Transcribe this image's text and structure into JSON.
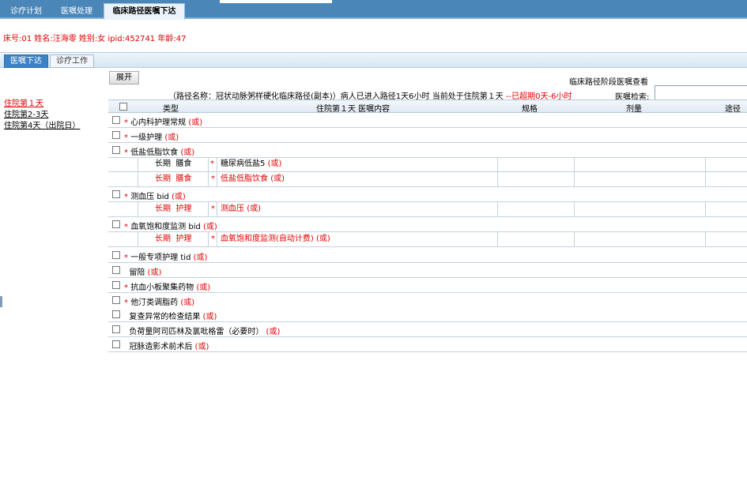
{
  "top_tabs": [
    {
      "label": "诊疗计划",
      "active": false
    },
    {
      "label": "医嘱处理",
      "active": false
    },
    {
      "label": "临床路径医嘱下达",
      "active": true
    }
  ],
  "patient_info": "床号:01 姓名:汪海零  姓别:女  ipid:452741 年龄:47",
  "sub_tabs": [
    {
      "label": "医嘱下达",
      "active": true
    },
    {
      "label": "诊疗工作",
      "active": false
    }
  ],
  "days": [
    {
      "label": "住院第１天",
      "current": true
    },
    {
      "label": "住院第2-3天",
      "current": false
    },
    {
      "label": "住院第4天（出院日）",
      "current": false
    }
  ],
  "toolbar": {
    "expand_label": "展开",
    "view_label": "临床路径阶段医嘱查看",
    "search_label": "医嘱检索:",
    "search_value": ""
  },
  "path_info": {
    "text": "（路径名称：冠状动脉粥样硬化临床路径(副本)）病人已进入路径1天6小时  当前处于住院第１天",
    "overdue": "--已超期0天-6小时"
  },
  "table_header": {
    "type": "类型",
    "content": "住院第１天  医嘱内容",
    "spec": "规格",
    "dose": "剂量",
    "route": "途径"
  },
  "rows": [
    {
      "kind": "item",
      "required": true,
      "text": "心内科护理常规",
      "or_label": "(或)"
    },
    {
      "kind": "item",
      "required": true,
      "text": "一级护理",
      "or_label": "(或)"
    },
    {
      "kind": "item",
      "required": true,
      "text": "低盐低脂饮食",
      "or_label": "(或)"
    },
    {
      "kind": "sub",
      "highlight": false,
      "term": "长期",
      "category": "膳食",
      "star": "*",
      "content": "糖尿病低盐5",
      "or_label": "(或)"
    },
    {
      "kind": "sub",
      "highlight": true,
      "term": "长期",
      "category": "膳食",
      "star": "*",
      "content": "低盐低脂饮食",
      "or_label": "(或)"
    },
    {
      "kind": "item",
      "required": true,
      "text": "测血压  bid",
      "or_label": "(或)"
    },
    {
      "kind": "sub",
      "highlight": true,
      "term": "长期",
      "category": "护理",
      "star": "*",
      "content": "测血压",
      "or_label": "(或)"
    },
    {
      "kind": "item",
      "required": true,
      "text": "血氧饱和度监测  bid",
      "or_label": "(或)"
    },
    {
      "kind": "sub",
      "highlight": true,
      "term": "长期",
      "category": "护理",
      "star": "*",
      "content": "血氧饱和度监测(自动计费)",
      "or_label": "(或)"
    },
    {
      "kind": "item",
      "required": true,
      "text": "一般专项护理  tid",
      "or_label": "(或)"
    },
    {
      "kind": "item",
      "required": false,
      "text": "留陪",
      "or_label": "(或)"
    },
    {
      "kind": "item",
      "required": true,
      "text": "抗血小板聚集药物",
      "or_label": "(或)"
    },
    {
      "kind": "item",
      "required": true,
      "text": "他汀类调脂药",
      "or_label": "(或)"
    },
    {
      "kind": "item",
      "required": false,
      "text": "复查异常的检查结果",
      "or_label": "(或)"
    },
    {
      "kind": "item",
      "required": false,
      "text": "负荷量阿司匹林及氯吡格雷（必要时）",
      "or_label": "(或)"
    },
    {
      "kind": "item",
      "required": false,
      "text": "冠脉造影术前术后",
      "or_label": "(或)"
    }
  ]
}
